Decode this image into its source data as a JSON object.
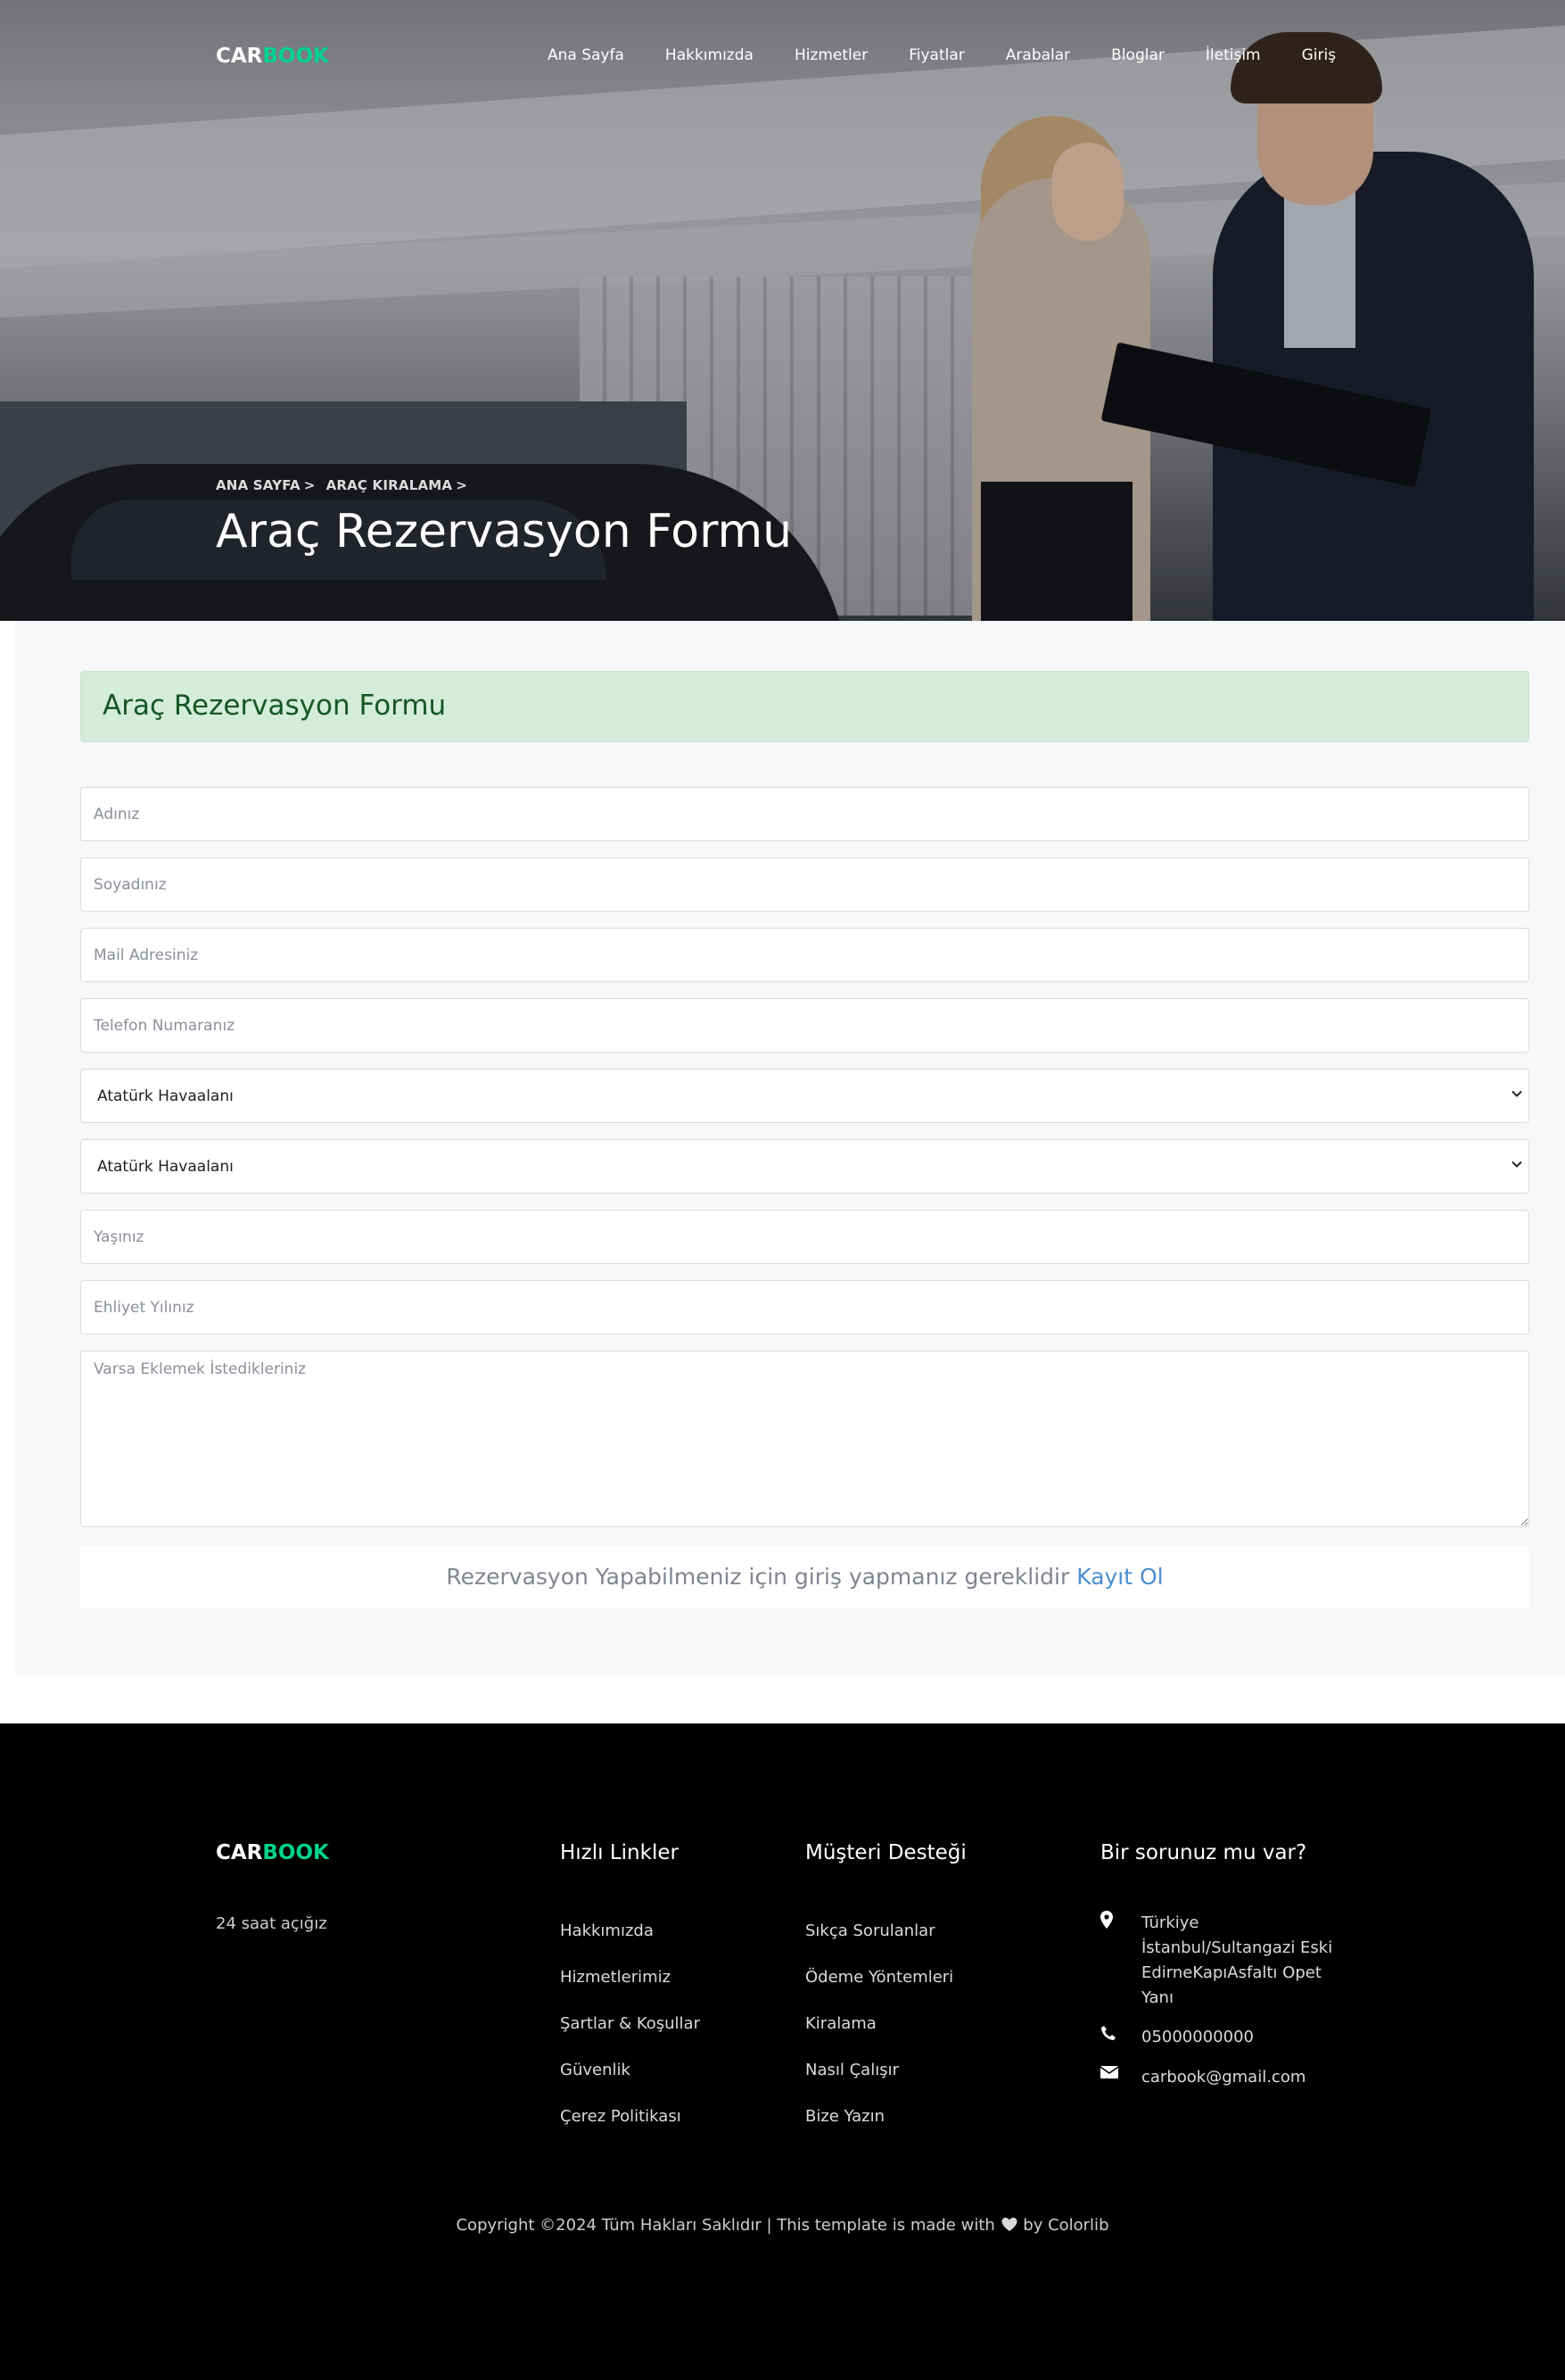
{
  "brand": {
    "part1": "CAR",
    "part2": "BOOK",
    "accent_color": "#01d28e"
  },
  "nav": {
    "items": [
      {
        "label": "Ana Sayfa"
      },
      {
        "label": "Hakkımızda"
      },
      {
        "label": "Hizmetler"
      },
      {
        "label": "Fiyatlar"
      },
      {
        "label": "Arabalar"
      },
      {
        "label": "Bloglar"
      },
      {
        "label": "İletişim"
      },
      {
        "label": "Giriş"
      }
    ]
  },
  "hero": {
    "breadcrumb": [
      {
        "label": "ANA SAYFA",
        "sep": ">"
      },
      {
        "label": "ARAÇ KIRALAMA",
        "sep": ">"
      }
    ],
    "title": "Araç Rezervasyon Formu"
  },
  "form": {
    "alert_title": "Araç Rezervasyon Formu",
    "name_placeholder": "Adınız",
    "surname_placeholder": "Soyadınız",
    "email_placeholder": "Mail Adresiniz",
    "phone_placeholder": "Telefon Numaranız",
    "pickup_location": "Atatürk Havaalanı",
    "dropoff_location": "Atatürk Havaalanı",
    "age_placeholder": "Yaşınız",
    "license_year_placeholder": "Ehliyet Yılınız",
    "notes_placeholder": "Varsa Eklemek İstedikleriniz",
    "notice_text": "Rezervasyon Yapabilmeniz için giriş yapmanız gereklidir",
    "notice_link": "Kayıt Ol"
  },
  "footer": {
    "open_hours": "24 saat açığız",
    "quick_links": {
      "title": "Hızlı Linkler",
      "items": [
        "Hakkımızda",
        "Hizmetlerimiz",
        "Şartlar & Koşullar",
        "Güvenlik",
        "Çerez Politikası"
      ]
    },
    "support": {
      "title": "Müşteri Desteği",
      "items": [
        "Sıkça Sorulanlar",
        "Ödeme Yöntemleri",
        "Kiralama",
        "Nasıl Çalışır",
        "Bize Yazın"
      ]
    },
    "contact": {
      "title": "Bir sorunuz mu var?",
      "address_line1": "Türkiye",
      "address_line2": "İstanbul/Sultangazi Eski",
      "address_line3": "EdirneKapıAsfaltı Opet",
      "address_line4": "Yanı",
      "phone": "05000000000",
      "email": "carbook@gmail.com"
    },
    "copyright_prefix": "Copyright ©2024 Tüm Hakları Saklıdır | This template is made with",
    "copyright_suffix": "by Colorlib"
  }
}
